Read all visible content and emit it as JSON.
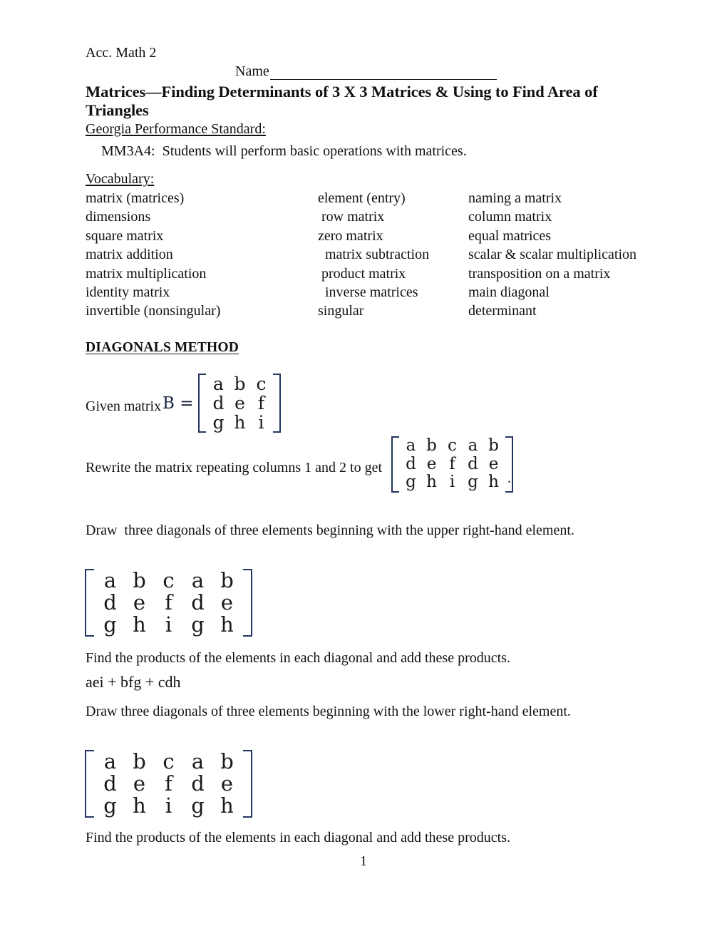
{
  "header": {
    "course": "Acc. Math 2",
    "name_label": "Name",
    "name_value": "",
    "title": "Matrices—Finding Determinants of 3 X 3 Matrices & Using to Find Area of Triangles"
  },
  "standard": {
    "heading": "Georgia Performance Standard:",
    "body": "MM3A4:  Students will perform basic operations with matrices."
  },
  "vocabulary": {
    "heading": "Vocabulary:",
    "rows": [
      [
        "matrix (matrices)",
        "element (entry)",
        "naming a matrix"
      ],
      [
        "dimensions",
        " row matrix",
        "column matrix"
      ],
      [
        "square matrix",
        "zero matrix",
        "equal matrices"
      ],
      [
        "matrix addition",
        "  matrix subtraction",
        "scalar & scalar multiplication"
      ],
      [
        "matrix multiplication",
        " product matrix",
        "transposition on a matrix"
      ],
      [
        "identity matrix",
        "  inverse matrices",
        "main diagonal"
      ],
      [
        "invertible (nonsingular)",
        "singular",
        "determinant"
      ]
    ]
  },
  "diagonals_method": {
    "heading": "DIAGONALS METHOD",
    "given_text": "Given matrix",
    "matrix_b_label": "B =",
    "matrix_b": [
      [
        "a",
        "b",
        "c"
      ],
      [
        "d",
        "e",
        "f"
      ],
      [
        "g",
        "h",
        "i"
      ]
    ],
    "rewrite_text": "Rewrite the matrix repeating columns 1 and 2 to get",
    "rewrite_period": ".",
    "matrix_rewritten": [
      [
        "a",
        "b",
        "c",
        "a",
        "b"
      ],
      [
        "d",
        "e",
        "f",
        "d",
        "e"
      ],
      [
        "g",
        "h",
        "i",
        "g",
        "h"
      ]
    ],
    "draw_upper_text": "Draw  three diagonals of three elements beginning with the upper right-hand element.",
    "matrix_upper": [
      [
        "a",
        "b",
        "c",
        "a",
        "b"
      ],
      [
        "d",
        "e",
        "f",
        "d",
        "e"
      ],
      [
        "g",
        "h",
        "i",
        "g",
        "h"
      ]
    ],
    "find_products_text_1": "Find the products of the elements in each diagonal and add these products.",
    "answer_upper": "aei + bfg + cdh",
    "draw_lower_text": "Draw three diagonals of three elements beginning with the lower right-hand element.",
    "matrix_lower": [
      [
        "a",
        "b",
        "c",
        "a",
        "b"
      ],
      [
        "d",
        "e",
        "f",
        "d",
        "e"
      ],
      [
        "g",
        "h",
        "i",
        "g",
        "h"
      ]
    ],
    "find_products_text_2": "Find the products of the elements in each diagonal and add these products."
  },
  "footer": {
    "page_number": "1"
  },
  "colors": {
    "text": "#111111",
    "matrix_bracket": "#24365f",
    "rule": "#1a1a1a",
    "background": "#ffffff"
  }
}
